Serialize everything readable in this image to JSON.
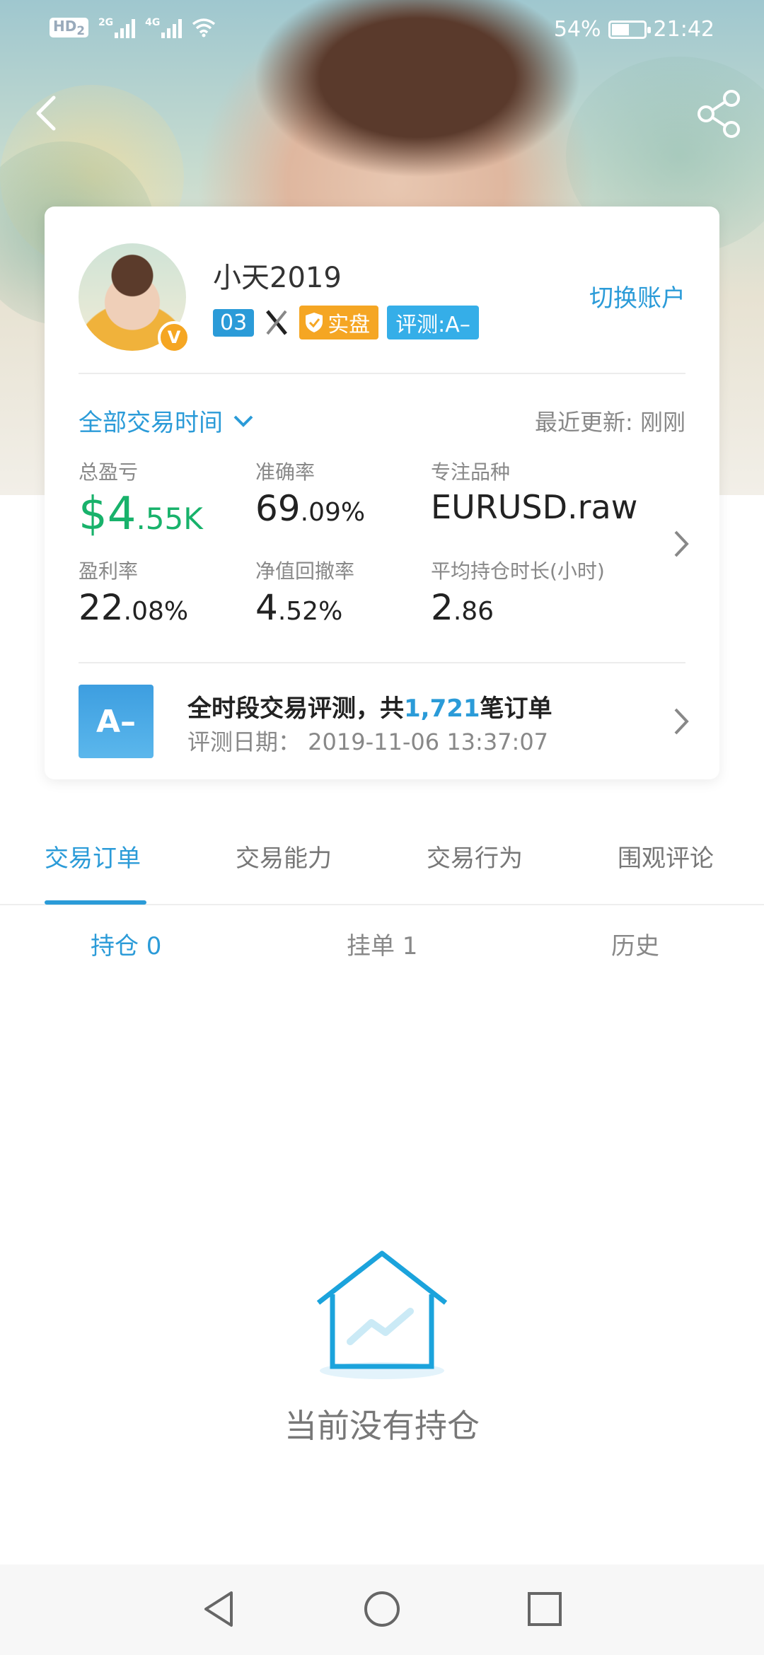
{
  "status_bar": {
    "hd_label": "HD",
    "sim_label": "2",
    "net1": "2G",
    "net2": "4G",
    "battery_percent_text": "54%",
    "battery_level": 0.54,
    "time": "21:42"
  },
  "header": {
    "back_icon": "chevron-left-icon",
    "share_icon": "share-icon"
  },
  "profile": {
    "username": "小天2019",
    "level_badge": "03",
    "real_badge": "实盘",
    "eval_badge": "评测:A–",
    "verified_badge": "V",
    "switch_account": "切换账户"
  },
  "filters": {
    "time_range": "全部交易时间",
    "last_updated": "最近更新: 刚刚"
  },
  "stats": [
    {
      "label": "总盈亏",
      "value_main": "$4",
      "value_small": ".55K"
    },
    {
      "label": "准确率",
      "value_main": "69",
      "value_small": ".09%"
    },
    {
      "label": "专注品种",
      "value_main": "EURUSD.raw",
      "value_small": ""
    },
    {
      "label": "盈利率",
      "value_main": "22",
      "value_small": ".08%"
    },
    {
      "label": "净值回撤率",
      "value_main": "4",
      "value_small": ".52%"
    },
    {
      "label": "平均持仓时长(小时)",
      "value_main": "2",
      "value_small": ".86"
    }
  ],
  "evaluation": {
    "grade": "A–",
    "title_prefix": "全时段交易评测，共",
    "order_count": "1,721",
    "title_suffix": "笔订单",
    "date_label": "评测日期： 2019-11-06 13:37:07"
  },
  "tabs": [
    {
      "label": "交易订单",
      "active": true
    },
    {
      "label": "交易能力",
      "active": false
    },
    {
      "label": "交易行为",
      "active": false
    },
    {
      "label": "围观评论",
      "active": false
    }
  ],
  "subtabs": [
    {
      "label": "持仓 0",
      "active": true
    },
    {
      "label": "挂单 1",
      "active": false
    },
    {
      "label": "历史",
      "active": false
    }
  ],
  "empty_state": {
    "icon": "house-chart-icon",
    "text": "当前没有持仓"
  },
  "colors": {
    "accent": "#2b9bd8",
    "profit_green": "#18b26b",
    "badge_orange": "#f5a623"
  }
}
